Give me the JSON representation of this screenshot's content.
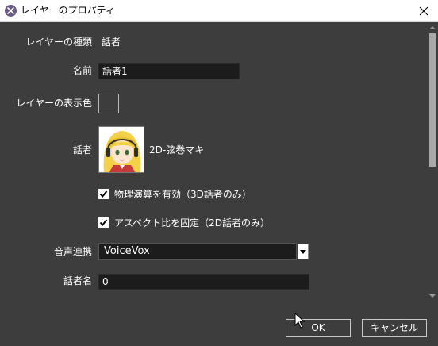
{
  "window": {
    "title": "レイヤーのプロパティ",
    "app_icon": "app-logo-icon",
    "close_icon": "close-icon"
  },
  "form": {
    "layer_type": {
      "label": "レイヤーの種類",
      "value": "話者"
    },
    "name": {
      "label": "名前",
      "value": "話者1"
    },
    "display_color": {
      "label": "レイヤーの表示色"
    },
    "speaker": {
      "label": "話者",
      "name": "2D-弦巻マキ",
      "avatar_icon": "speaker-avatar-icon"
    },
    "physics": {
      "label": "物理演算を有効（3D話者のみ）",
      "checked": true
    },
    "aspect": {
      "label": "アスペクト比を固定（2D話者のみ）",
      "checked": true
    },
    "voice_link": {
      "label": "音声連携",
      "selected": "VoiceVox",
      "arrow_icon": "chevron-down-icon"
    },
    "speaker_name": {
      "label": "話者名",
      "value": "0"
    }
  },
  "buttons": {
    "ok": "OK",
    "cancel": "キャンセル"
  },
  "colors": {
    "background": "#3d3d3d",
    "input_bg": "#1c1c1c",
    "titlebar": "#ffffff"
  }
}
